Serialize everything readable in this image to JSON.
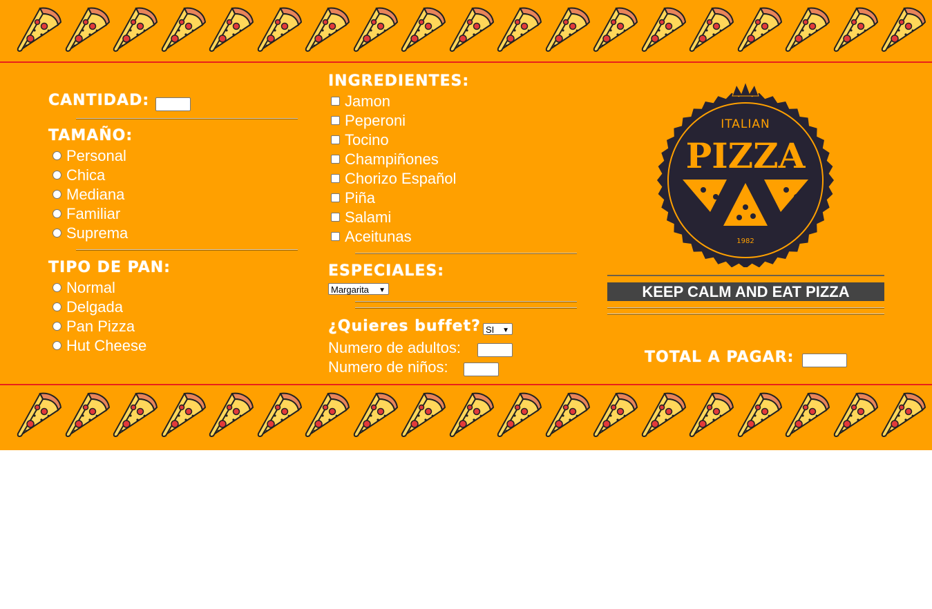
{
  "header": {
    "icon": "pizza-slice-icon",
    "count": 19
  },
  "footer": {
    "icon": "pizza-slice-icon",
    "count": 19
  },
  "colors": {
    "background": "#FFA000",
    "border": "#e8201a",
    "text": "#ffffff",
    "banner": "#444444"
  },
  "cantidad": {
    "label": "CANTIDAD:",
    "value": ""
  },
  "tamano": {
    "label": "TAMAÑO:",
    "options": [
      "Personal",
      "Chica",
      "Mediana",
      "Familiar",
      "Suprema"
    ]
  },
  "tipo_pan": {
    "label": "TIPO DE PAN:",
    "options": [
      "Normal",
      "Delgada",
      "Pan Pizza",
      "Hut Cheese"
    ]
  },
  "ingredientes": {
    "label": "INGREDIENTES:",
    "options": [
      "Jamon",
      "Peperoni",
      "Tocino",
      "Champiñones",
      "Chorizo Español",
      "Piña",
      "Salami",
      "Aceitunas"
    ]
  },
  "especiales": {
    "label": "ESPECIALES:",
    "selected": "Margarita"
  },
  "buffet": {
    "label": "¿Quieres buffet?",
    "selected": "SI",
    "adultos_label": "Numero de adultos:",
    "ninos_label": "Numero de niños:"
  },
  "logo": {
    "top": "ITALIAN",
    "main": "PIZZA",
    "year": "1982"
  },
  "banner": {
    "text": "KEEP CALM AND EAT PIZZA"
  },
  "total": {
    "label": "TOTAL A PAGAR:",
    "value": ""
  }
}
